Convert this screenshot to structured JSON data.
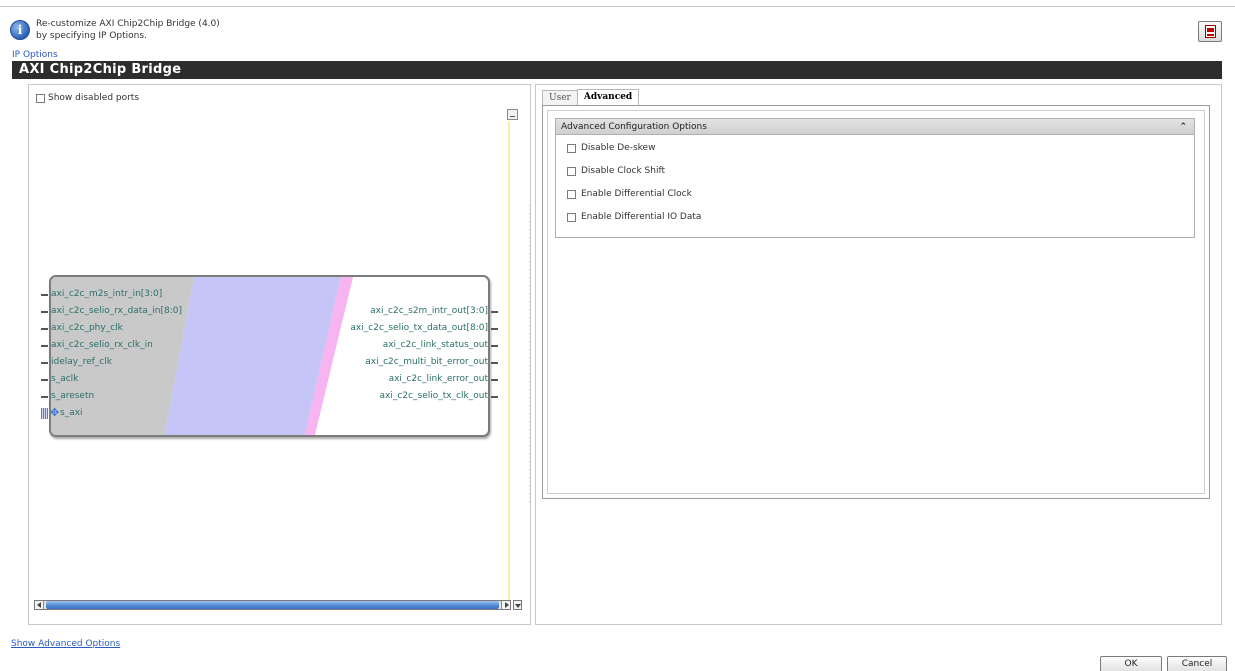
{
  "header": {
    "line1": "Re-customize AXI Chip2Chip Bridge (4.0)",
    "line2": "by specifying IP Options."
  },
  "ip_options_label": "IP Options",
  "title": "AXI Chip2Chip Bridge",
  "left_panel": {
    "show_disabled_ports": "Show disabled ports",
    "input_ports": [
      "axi_c2c_m2s_intr_in[3:0]",
      "axi_c2c_selio_rx_data_in[8:0]",
      "axi_c2c_phy_clk",
      "axi_c2c_selio_rx_clk_in",
      "idelay_ref_clk",
      "s_aclk",
      "s_aresetn",
      "s_axi"
    ],
    "output_ports": [
      "axi_c2c_s2m_intr_out[3:0]",
      "axi_c2c_selio_tx_data_out[8:0]",
      "axi_c2c_link_status_out",
      "axi_c2c_multi_bit_error_out",
      "axi_c2c_link_error_out",
      "axi_c2c_selio_tx_clk_out"
    ],
    "block_colors": {
      "gray": "#c9c9c9",
      "lavender": "#c5c5f7",
      "pink": "#f8b4f0"
    }
  },
  "tabs": [
    {
      "label": "User",
      "active": false
    },
    {
      "label": "Advanced",
      "active": true
    }
  ],
  "advanced": {
    "section_title": "Advanced Configuration Options",
    "section_icon": "double-chevron-up-icon",
    "options": [
      {
        "label": "Disable De-skew",
        "checked": false
      },
      {
        "label": "Disable Clock Shift",
        "checked": false
      },
      {
        "label": "Enable Differential Clock",
        "checked": false
      },
      {
        "label": "Enable Differential IO Data",
        "checked": false
      }
    ]
  },
  "footer": {
    "show_advanced": "Show Advanced Options",
    "ok": "OK",
    "cancel": "Cancel"
  }
}
